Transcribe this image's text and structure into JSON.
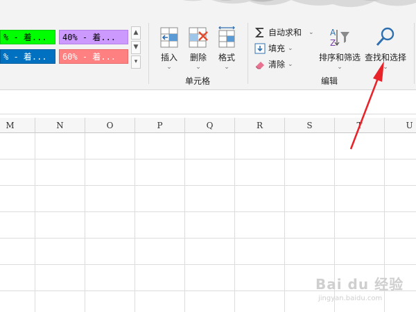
{
  "cell_styles": {
    "items": [
      {
        "label": "% - 着...",
        "bg": "#00ff00",
        "fg": "#000000"
      },
      {
        "label": "40% - 着...",
        "bg": "#cc99ff",
        "fg": "#000000"
      },
      {
        "label": "% - 着...",
        "bg": "#0070c0",
        "fg": "#ffffff"
      },
      {
        "label": "60% - 着...",
        "bg": "#ff8080",
        "fg": "#ffffff"
      }
    ]
  },
  "cells_group": {
    "label": "单元格",
    "insert_label": "插入",
    "delete_label": "删除",
    "format_label": "格式"
  },
  "editing_group": {
    "label": "编辑",
    "autosum_label": "自动求和",
    "fill_label": "填充",
    "clear_label": "清除",
    "sort_filter_label": "排序和筛选",
    "find_select_label": "查找和选择"
  },
  "sheet": {
    "columns": [
      "M",
      "N",
      "O",
      "P",
      "Q",
      "R",
      "S",
      "T",
      "U"
    ]
  },
  "annotation": {
    "color": "#e8232a"
  },
  "watermark": {
    "brand": "Bai du 经验",
    "url": "jingyan.baidu.com"
  }
}
